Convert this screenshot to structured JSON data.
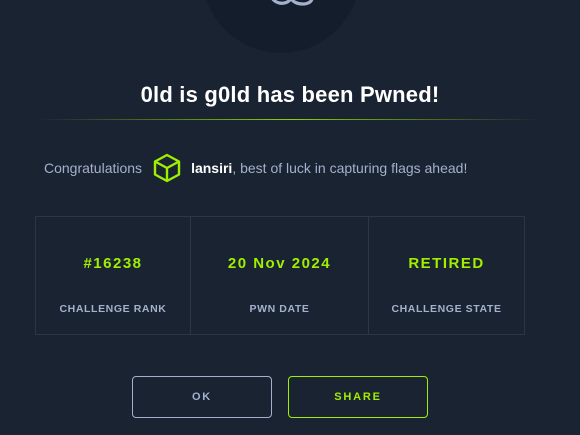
{
  "badge": {
    "icon": "htb-infinity-logo-icon"
  },
  "modal": {
    "title": "0ld is g0ld has been Pwned!",
    "congrats_prefix": "Congratulations",
    "avatar_icon": "hexagon-cube-icon",
    "username": "lansiri",
    "congrats_suffix": ", best of luck in capturing flags ahead!"
  },
  "stats": [
    {
      "value": "#16238",
      "label": "CHALLENGE RANK"
    },
    {
      "value": "20 Nov 2024",
      "label": "PWN DATE"
    },
    {
      "value": "RETIRED",
      "label": "CHALLENGE STATE"
    }
  ],
  "buttons": {
    "ok_label": "OK",
    "share_label": "SHARE"
  },
  "colors": {
    "background": "#1a2332",
    "accent": "#9fef00",
    "muted_text": "#a4b1cd",
    "title_text": "#ffffff"
  }
}
